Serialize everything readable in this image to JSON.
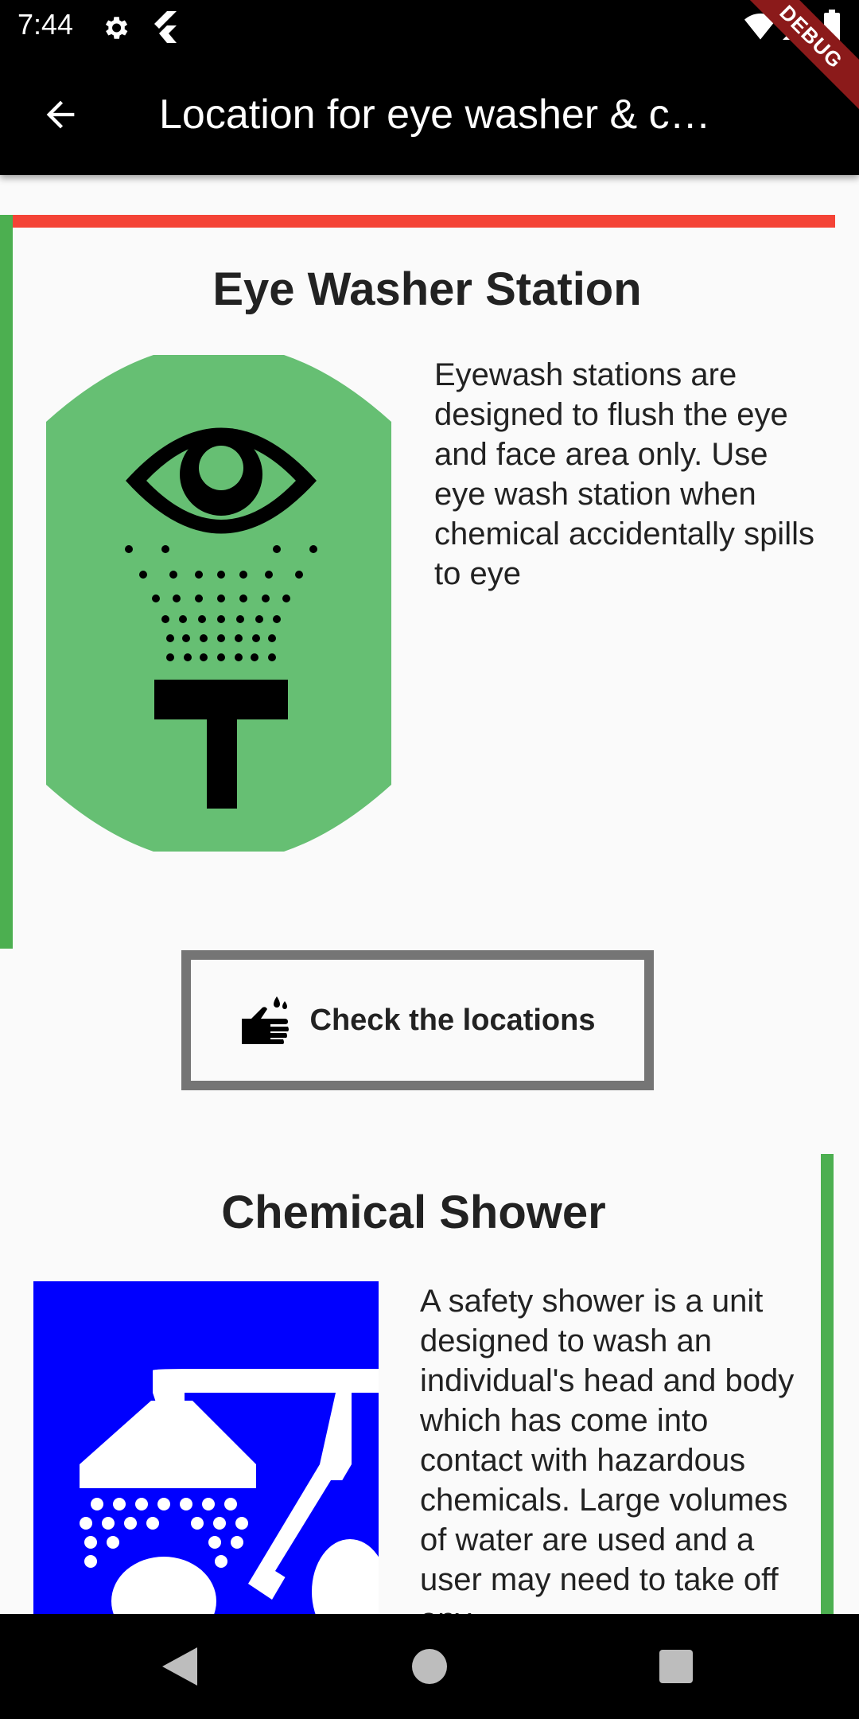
{
  "status_bar": {
    "time": "7:44",
    "icons": [
      "gear-icon",
      "flutter-icon",
      "wifi-icon",
      "signal-icon",
      "battery-icon"
    ]
  },
  "app_bar": {
    "title": "Location for eye washer & chemical shower",
    "back_icon": "arrow-back-icon",
    "debug_label": "DEBUG"
  },
  "cards": [
    {
      "title": "Eye Washer Station",
      "description": "Eyewash stations are designed to flush the eye and face area only. Use eye wash station when chemical accidentally spills to eye",
      "image_icon": "eye-wash-icon",
      "colors": {
        "top_border": "#f44336",
        "side_border": "#4caf50",
        "image_bg": "#66bf73"
      }
    },
    {
      "title": "Chemical Shower",
      "description": "A safety shower is a unit designed to wash an individual's head and body which has come into contact with hazardous chemicals. Large volumes of water are used and a user may need to take off any",
      "image_icon": "safety-shower-icon",
      "colors": {
        "side_border": "#4caf50",
        "image_bg": "#0000ff"
      }
    }
  ],
  "check_button": {
    "label": "Check the locations",
    "icon": "hand-wash-icon",
    "border_color": "#757575"
  },
  "nav_bar": {
    "icons": [
      "back-triangle-icon",
      "home-circle-icon",
      "recents-square-icon"
    ]
  }
}
